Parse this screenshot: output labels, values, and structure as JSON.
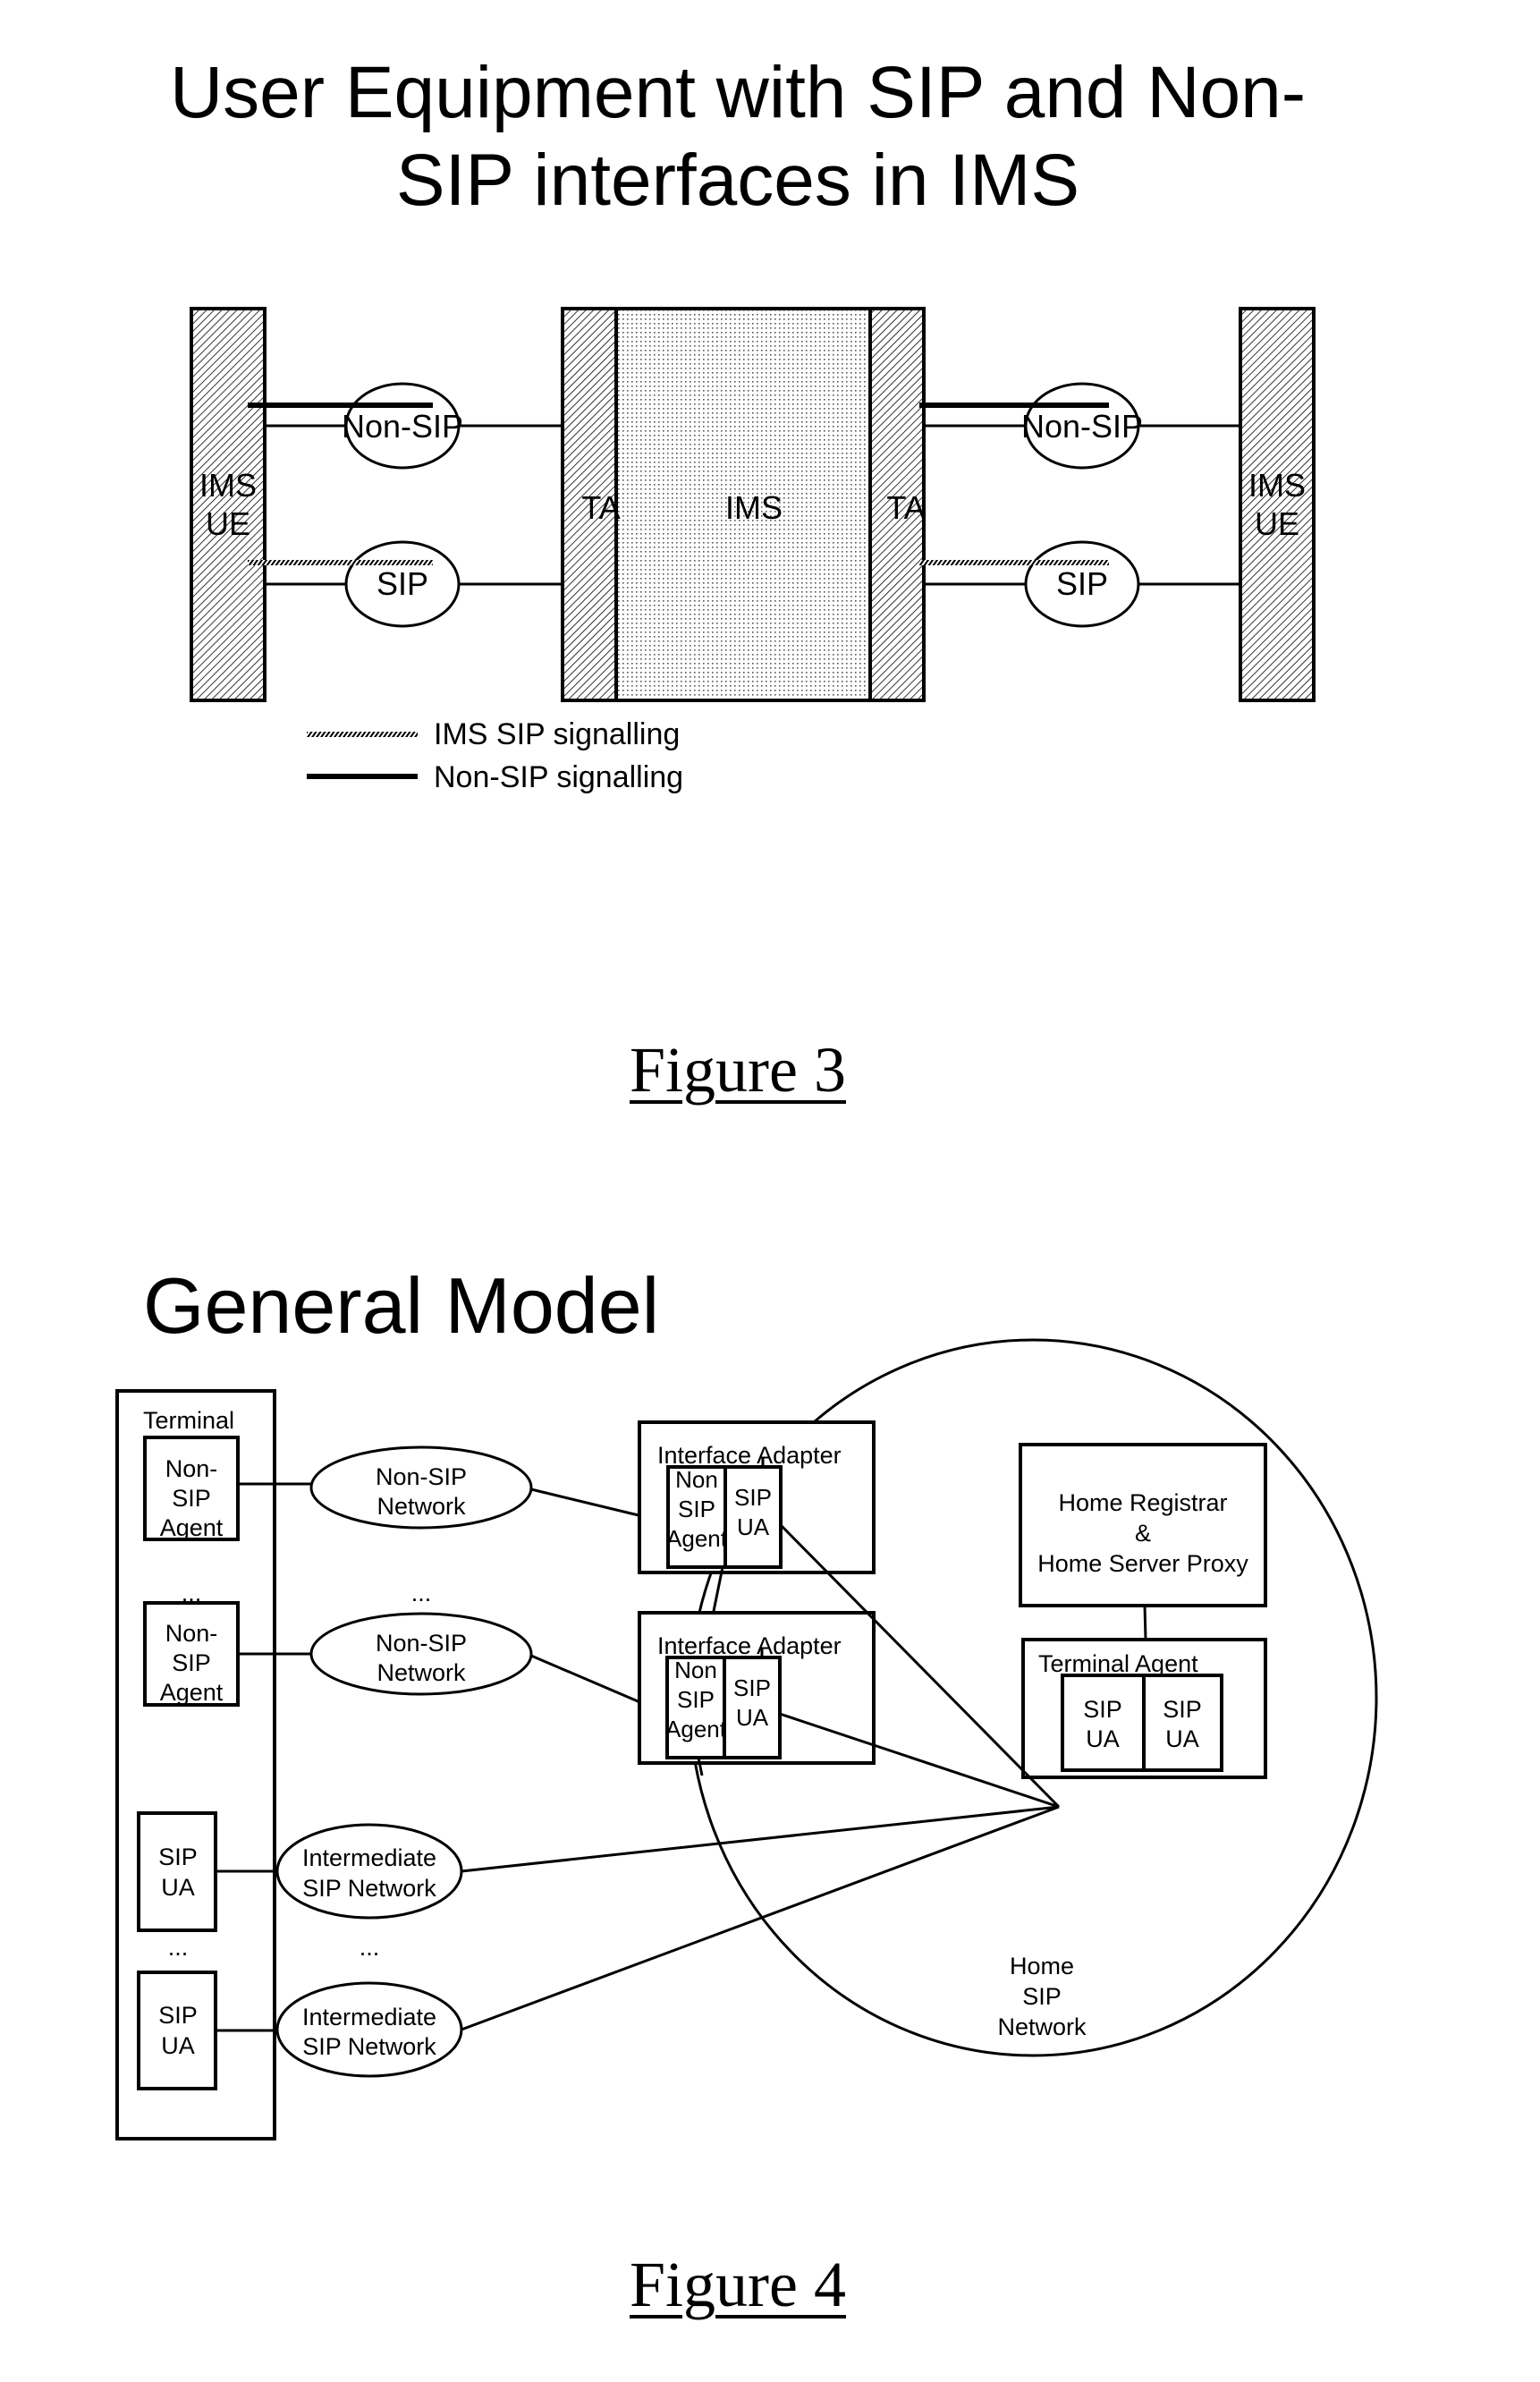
{
  "figure3": {
    "title_line1": "User Equipment with SIP and Non-",
    "title_line2": "SIP interfaces in IMS",
    "left_ue": {
      "line1": "IMS",
      "line2": "UE"
    },
    "right_ue": {
      "line1": "IMS",
      "line2": "UE"
    },
    "left_ta": "TA",
    "core": "IMS",
    "right_ta": "TA",
    "left_nonsip_cloud": "Non-SIP",
    "left_sip_cloud": "SIP",
    "right_nonsip_cloud": "Non-SIP",
    "right_sip_cloud": "SIP",
    "legend": [
      {
        "style": "hatched",
        "label": "IMS SIP signalling"
      },
      {
        "style": "solid",
        "label": "Non-SIP signalling"
      }
    ],
    "caption": "Figure 3"
  },
  "figure4": {
    "title": "General Model",
    "terminal": {
      "label": "Terminal",
      "agents": [
        {
          "line1": "Non-",
          "line2": "SIP",
          "line3": "Agent"
        },
        {
          "line1": "Non-",
          "line2": "SIP",
          "line3": "Agent"
        },
        {
          "line1": "SIP",
          "line2": "UA"
        },
        {
          "line1": "SIP",
          "line2": "UA"
        }
      ],
      "ellipsis": "..."
    },
    "networks": [
      {
        "line1": "Non-SIP",
        "line2": "Network"
      },
      {
        "line1": "Non-SIP",
        "line2": "Network"
      },
      {
        "line1": "Intermediate",
        "line2": "SIP Network"
      },
      {
        "line1": "Intermediate",
        "line2": "SIP Network"
      }
    ],
    "network_ellipsis": "...",
    "interface_adapters": [
      {
        "label": "Interface Adapter",
        "agent": {
          "line1": "Non",
          "line2": "SIP",
          "line3": "Agent"
        },
        "ua": {
          "line1": "SIP",
          "line2": "UA"
        }
      },
      {
        "label": "Interface Adapter",
        "agent": {
          "line1": "Non",
          "line2": "SIP",
          "line3": "Agent"
        },
        "ua": {
          "line1": "SIP",
          "line2": "UA"
        }
      }
    ],
    "home_registrar": {
      "line1": "Home Registrar",
      "line2": "&",
      "line3": "Home Server Proxy"
    },
    "terminal_agent": {
      "label": "Terminal Agent",
      "uas": [
        {
          "line1": "SIP",
          "line2": "UA"
        },
        {
          "line1": "SIP",
          "line2": "UA"
        }
      ]
    },
    "home_network": {
      "line1": "Home",
      "line2": "SIP",
      "line3": "Network"
    },
    "caption": "Figure 4"
  }
}
